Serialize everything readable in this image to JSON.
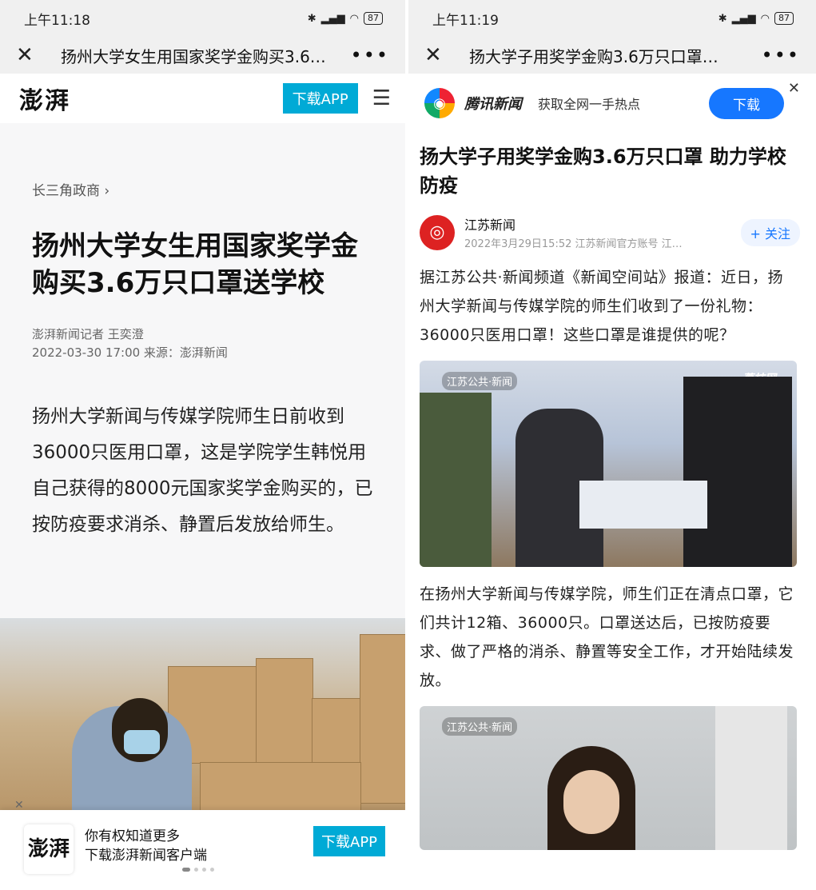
{
  "left": {
    "status": {
      "time": "上午11:18",
      "battery": "87"
    },
    "nav": {
      "title": "扬州大学女生用国家奖学金购买3.6…"
    },
    "header": {
      "logo": "澎湃",
      "download_label": "下载APP"
    },
    "article": {
      "breadcrumb": "长三角政商 ›",
      "title": "扬州大学女生用国家奖学金购买3.6万只口罩送学校",
      "reporter": "澎湃新闻记者 王奕澄",
      "date_source": "2022-03-30 17:00  来源：澎湃新闻",
      "body": "扬州大学新闻与传媒学院师生日前收到36000只医用口罩，这是学院学生韩悦用自己获得的8000元国家奖学金购买的，已按防疫要求消杀、静置后发放给师生。"
    },
    "banner": {
      "logo": "澎湃",
      "line1": "你有权知道更多",
      "line2": "下载澎湃新闻客户端",
      "button": "下载APP"
    }
  },
  "right": {
    "status": {
      "time": "上午11:19",
      "battery": "87"
    },
    "nav": {
      "title": "扬大学子用奖学金购3.6万只口罩…"
    },
    "app_banner": {
      "name": "腾讯新闻",
      "slogan": "获取全网一手热点",
      "button": "下载"
    },
    "article": {
      "title": "扬大学子用奖学金购3.6万只口罩 助力学校防疫",
      "author": "江苏新闻",
      "author_meta": "2022年3月29日15:52 江苏新闻官方账号 江…",
      "follow": "+ 关注",
      "para1": "据江苏公共·新闻频道《新闻空间站》报道：近日，扬州大学新闻与传媒学院的师生们收到了一份礼物：36000只医用口罩！这些口罩是谁提供的呢？",
      "para2": "在扬州大学新闻与传媒学院，师生们正在清点口罩，它们共计12箱、36000只。口罩送达后，已按防疫要求、做了严格的消杀、静置等安全工作，才开始陆续发放。",
      "video_logo": "江苏公共·新闻",
      "video_logo2": "荔枝网"
    }
  }
}
